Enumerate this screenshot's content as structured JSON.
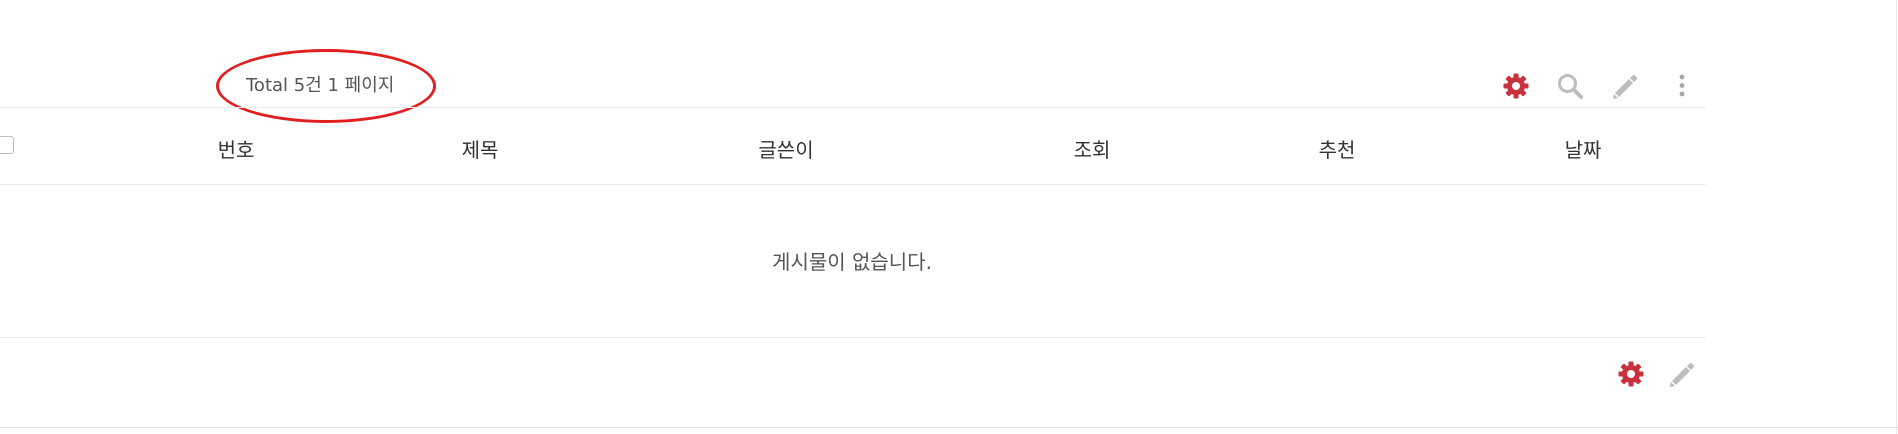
{
  "board": {
    "total_text": "Total 5건 1 페이지",
    "columns": [
      "번호",
      "제목",
      "글쓴이",
      "조회",
      "추천",
      "날짜"
    ],
    "empty_message": "게시물이 없습니다."
  },
  "icons": {
    "settings": "gear-icon",
    "search": "search-icon",
    "write": "pencil-icon",
    "more": "more-vertical-icon"
  },
  "colors": {
    "accent": "#c9313c",
    "icon_gray": "#bdbdbd",
    "highlight": "#e02020"
  }
}
